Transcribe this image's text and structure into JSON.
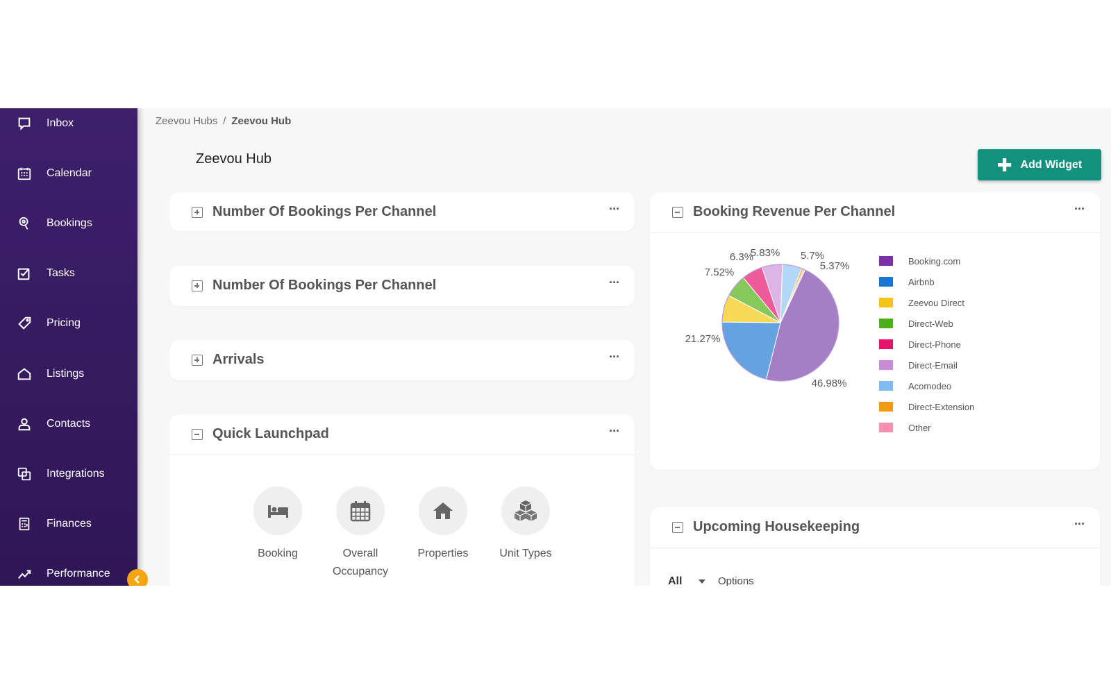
{
  "breadcrumb": {
    "parent": "Zeevou Hubs",
    "separator": "/",
    "current": "Zeevou Hub"
  },
  "page_title": "Zeevou Hub",
  "add_widget": {
    "icon": "plus-icon",
    "label": "Add Widget"
  },
  "colors": {
    "sidebar": "#3d1f6b",
    "accent": "#13907e",
    "collapse": "#f5a511"
  },
  "sidebar": {
    "items": [
      {
        "label": "Inbox",
        "icon": "chat-icon"
      },
      {
        "label": "Calendar",
        "icon": "calendar-icon"
      },
      {
        "label": "Bookings",
        "icon": "location-icon"
      },
      {
        "label": "Tasks",
        "icon": "checkbox-icon"
      },
      {
        "label": "Pricing",
        "icon": "tag-icon"
      },
      {
        "label": "Listings",
        "icon": "home-icon"
      },
      {
        "label": "Contacts",
        "icon": "user-icon"
      },
      {
        "label": "Integrations",
        "icon": "integrations-icon"
      },
      {
        "label": "Finances",
        "icon": "calculator-icon"
      },
      {
        "label": "Performance",
        "icon": "chart-line-icon"
      }
    ],
    "collapse_icon": "chevron-left-icon"
  },
  "widgets": {
    "bookings_per_channel_1": {
      "title": "Number Of Bookings Per Channel",
      "menu": "···"
    },
    "bookings_per_channel_2": {
      "title": "Number Of Bookings Per Channel",
      "menu": "···"
    },
    "arrivals": {
      "title": "Arrivals",
      "menu": "···"
    },
    "quick_launchpad": {
      "title": "Quick Launchpad",
      "menu": "···",
      "items": [
        {
          "label": "Booking",
          "icon": "bed-icon"
        },
        {
          "label": "Overall Occupancy",
          "icon": "calendar-grid-icon"
        },
        {
          "label": "Properties",
          "icon": "house-icon"
        },
        {
          "label": "Unit Types",
          "icon": "cubes-icon"
        }
      ]
    },
    "booking_revenue": {
      "title": "Booking Revenue Per Channel",
      "menu": "···"
    },
    "housekeeping": {
      "title": "Upcoming Housekeeping",
      "menu": "···",
      "filter": "All",
      "options": "Options"
    }
  },
  "chart_data": {
    "type": "pie",
    "title": "",
    "legend_position": "right",
    "series": [
      {
        "name": "Booking.com",
        "value": 46.98,
        "label": "46.98%",
        "color": "#7b2fa8",
        "slice_color": "#a57fc5"
      },
      {
        "name": "Airbnb",
        "value": 21.27,
        "label": "21.27%",
        "color": "#1976d2",
        "slice_color": "#64a2e2"
      },
      {
        "name": "Zeevou Direct",
        "value": 7.52,
        "label": "7.52%",
        "color": "#f6c417",
        "slice_color": "#f8d957"
      },
      {
        "name": "Direct-Web",
        "value": 6.3,
        "label": "6.3%",
        "color": "#4caf1a",
        "slice_color": "#86c95a"
      },
      {
        "name": "Direct-Phone",
        "value": 5.83,
        "label": "5.83%",
        "color": "#e8116b",
        "slice_color": "#ee5a9a"
      },
      {
        "name": "Direct-Email",
        "value": 5.7,
        "label": "5.7%",
        "color": "#c98bd8",
        "slice_color": "#dcb5e6"
      },
      {
        "name": "Acomodeo",
        "value": 5.37,
        "label": "5.37%",
        "color": "#7ebcf2",
        "slice_color": "#b3d7f6"
      },
      {
        "name": "Direct-Extension",
        "value": 0.6,
        "label": "",
        "color": "#f39a12",
        "slice_color": "#f5b653"
      },
      {
        "name": "Other",
        "value": 0.43,
        "label": "",
        "color": "#f48fb1",
        "slice_color": "#f7b3c9"
      }
    ]
  }
}
